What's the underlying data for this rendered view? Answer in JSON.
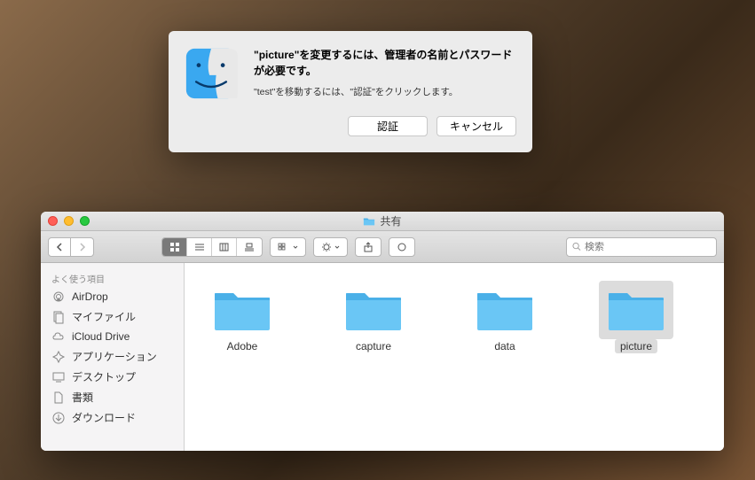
{
  "dialog": {
    "title": "\"picture\"を変更するには、管理者の名前とパスワードが必要です。",
    "message": "\"test\"を移動するには、\"認証\"をクリックします。",
    "auth_button": "認証",
    "cancel_button": "キャンセル"
  },
  "finder": {
    "title": "共有",
    "search_placeholder": "検索",
    "sidebar": {
      "header": "よく使う項目",
      "items": [
        {
          "label": "AirDrop",
          "icon": "airdrop"
        },
        {
          "label": "マイファイル",
          "icon": "myfiles"
        },
        {
          "label": "iCloud Drive",
          "icon": "icloud"
        },
        {
          "label": "アプリケーション",
          "icon": "apps"
        },
        {
          "label": "デスクトップ",
          "icon": "desktop"
        },
        {
          "label": "書類",
          "icon": "documents"
        },
        {
          "label": "ダウンロード",
          "icon": "downloads"
        }
      ]
    },
    "folders": [
      {
        "name": "Adobe",
        "selected": false
      },
      {
        "name": "capture",
        "selected": false
      },
      {
        "name": "data",
        "selected": false
      },
      {
        "name": "picture",
        "selected": true
      }
    ]
  }
}
